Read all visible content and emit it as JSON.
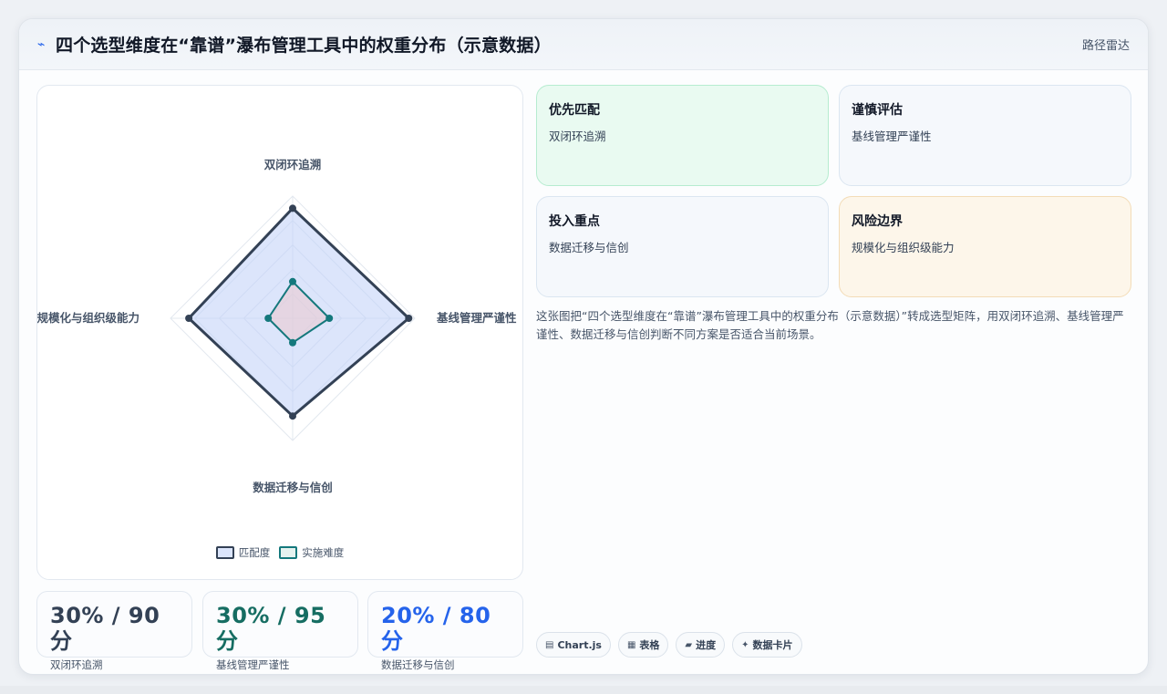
{
  "header": {
    "title": "四个选型维度在“靠谱”瀑布管理工具中的权重分布（示意数据）",
    "subtitle": "路径雷达",
    "logo_icon": "pulse-icon"
  },
  "chart_data": {
    "type": "radar",
    "categories": [
      "双闭环追溯",
      "基线管理严谨性",
      "数据迁移与信创",
      "规模化与组织级能力"
    ],
    "series": [
      {
        "name": "匹配度",
        "values": [
          90,
          95,
          80,
          85
        ],
        "color": "#334155",
        "fill": "rgba(191,208,248,0.55)"
      },
      {
        "name": "实施难度",
        "values": [
          30,
          30,
          20,
          20
        ],
        "color": "#14787c",
        "fill": "rgba(236,200,205,0.55)"
      }
    ],
    "rmax": 100,
    "grid": true,
    "legend_position": "bottom"
  },
  "stats": [
    {
      "value": "30% / 90分",
      "label": "双闭环追溯",
      "color": "#334155"
    },
    {
      "value": "30% / 95分",
      "label": "基线管理严谨性",
      "color": "#166d62"
    },
    {
      "value": "20% / 80分",
      "label": "数据迁移与信创",
      "color": "#2563eb"
    }
  ],
  "tiles": [
    {
      "title": "优先匹配",
      "subtitle": "双闭环追溯",
      "bg": "#e9faf1",
      "border": "#b6ecd0"
    },
    {
      "title": "谨慎评估",
      "subtitle": "基线管理严谨性",
      "bg": "#f5f8fc",
      "border": "#dbe6f1"
    },
    {
      "title": "投入重点",
      "subtitle": "数据迁移与信创",
      "bg": "#f5f8fc",
      "border": "#dbe6f1"
    },
    {
      "title": "风险边界",
      "subtitle": "规模化与组织级能力",
      "bg": "#fdf6ea",
      "border": "#f3dcb7"
    }
  ],
  "description": "这张图把“四个选型维度在“靠谱”瀑布管理工具中的权重分布（示意数据）”转成选型矩阵，用双闭环追溯、基线管理严谨性、数据迁移与信创判断不同方案是否适合当前场景。",
  "chips": [
    {
      "icon": "▤",
      "label": "Chart.js"
    },
    {
      "icon": "▦",
      "label": "表格"
    },
    {
      "icon": "▰",
      "label": "进度"
    },
    {
      "icon": "✦",
      "label": "数据卡片"
    }
  ]
}
